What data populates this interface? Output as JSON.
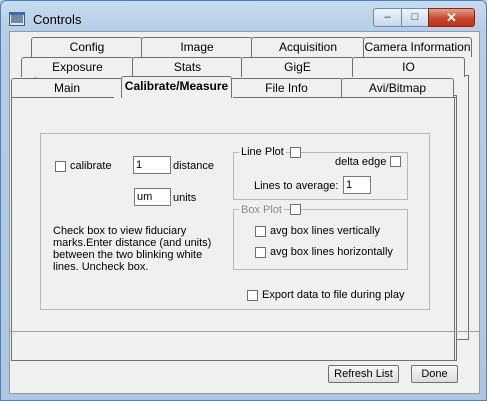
{
  "window": {
    "title": "Controls",
    "min_label": "–",
    "max_label": "□",
    "close_label": "✕",
    "icon": "app-window-icon"
  },
  "tabs": {
    "row1": [
      "Config",
      "Image",
      "Acquisition",
      "Camera Information"
    ],
    "row2": [
      "Exposure",
      "Stats",
      "GigE",
      "IO"
    ],
    "row3": [
      "Main",
      "Calibrate/Measure",
      "File Info",
      "Avi/Bitmap"
    ]
  },
  "calibrate": {
    "checkbox_label": "calibrate",
    "distance_value": "1",
    "distance_label": "distance",
    "units_value": "um",
    "units_label": "units",
    "help_text": "Check box to view fiduciary marks.Enter distance (and units) between the two blinking white lines. Uncheck box."
  },
  "line_plot": {
    "label": "Line Plot",
    "delta_edge_label": "delta edge",
    "lines_to_average_label": "Lines to average:",
    "lines_to_average_value": "1"
  },
  "box_plot": {
    "label": "Box Plot",
    "avg_vertical_label": "avg box lines vertically",
    "avg_horizontal_label": "avg box lines horizontally"
  },
  "export": {
    "label": "Export data to file during play"
  },
  "footer": {
    "refresh_label": "Refresh List",
    "done_label": "Done"
  },
  "colors": {
    "title_bar": "#c9dcf0",
    "close_button": "#c9452c",
    "panel": "#f0f0f0"
  }
}
